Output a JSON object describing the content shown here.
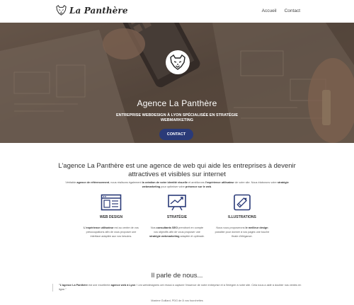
{
  "nav": {
    "logo_text": "La Panthère",
    "links": [
      "Accueil",
      "Contact"
    ]
  },
  "hero": {
    "title": "Agence La Panthère",
    "subtitle": "ENTREPRISE WEBDESIGN À LYON SPÉCIALISÉE EN STRATÉGIE WEBMARKETING",
    "button_label": "CONTACT",
    "button_color": "#2a3a78"
  },
  "intro": {
    "title": "L'agence La Panthère est une agence de web qui aide les entreprises à devenir attractives et visibles sur internet",
    "text_parts": [
      "Véritable ",
      "agence de référencement",
      ", nous réalisons également ",
      "la création de votre identité visuelle",
      " et améliorons ",
      "l'expérience utilisateur",
      " de votre site. Nous élaborons votre ",
      "stratégie webmarketing",
      " pour optimiser votre ",
      "présence sur le web",
      "."
    ]
  },
  "services": [
    {
      "icon": "web-design-icon",
      "title": "WEB DESIGN",
      "text_parts": [
        "",
        "L'expérience utilisateur",
        " est au centre de vos préoccupations afin de vous proposer une interface adaptée aux vos besoins."
      ]
    },
    {
      "icon": "strategy-icon",
      "title": "STRATÉGIE",
      "text_parts": [
        "Nos ",
        "consultants SEO",
        " prendront en compte vos objectifs afin de vous proposer une ",
        "stratégie webmarketing",
        " adaptée et optimale."
      ]
    },
    {
      "icon": "illustration-icon",
      "title": "ILLUSTRATIONS",
      "text_parts": [
        "Nous vous proposerons ",
        "le meilleur design",
        " possible pour donner à vos pages une touche finale d'élégance."
      ]
    }
  ],
  "testimonial": {
    "title": "Il parle de nous...",
    "quote_parts": [
      "\"L'agence La Panthère",
      " est une excellente ",
      "agence web à Lyon",
      " ! Les webdesigners ont réussi à capturer l'essence de notre entreprise et à l'intégrer à notre site. Cela nous a aidé à doubler nos ventes en ligne.\""
    ],
    "author": "Maxime Guillard, PDG de À vos fourchettes"
  }
}
